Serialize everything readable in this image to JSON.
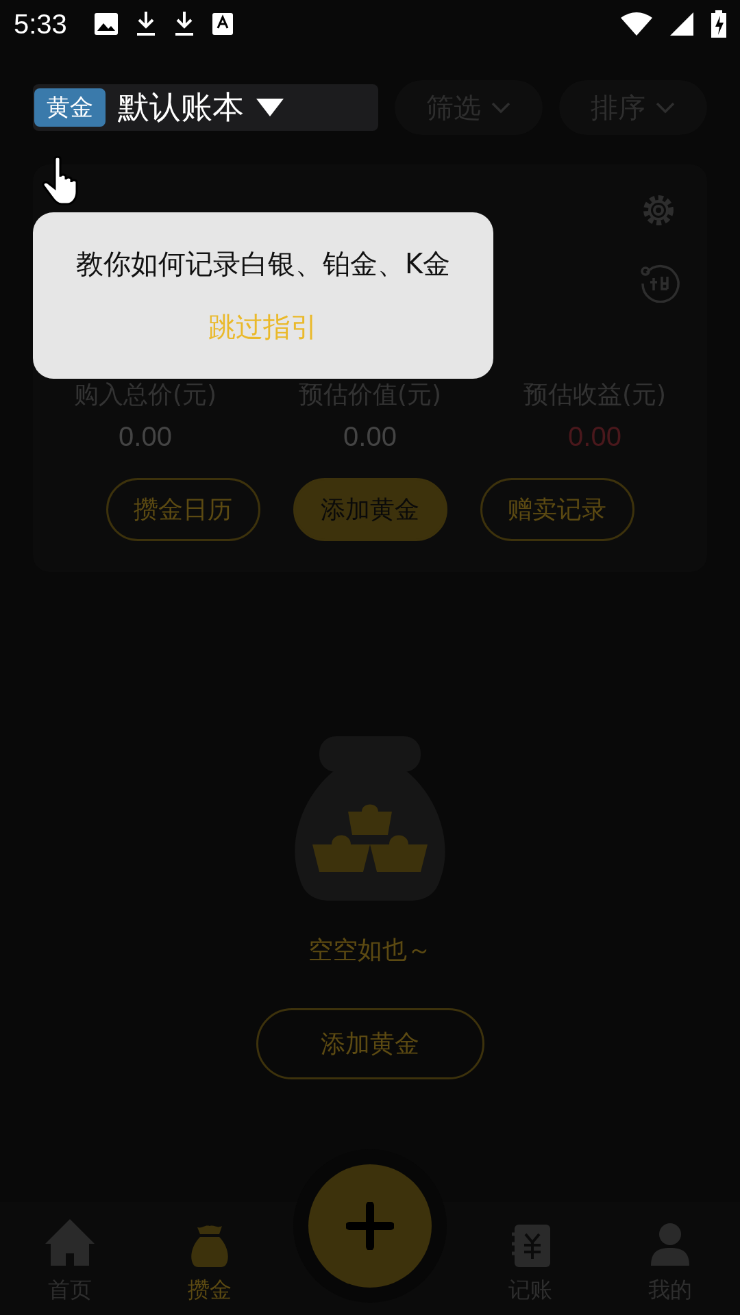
{
  "status_bar": {
    "time": "5:33"
  },
  "account": {
    "tag": "黄金",
    "name": "默认账本"
  },
  "filters": [
    {
      "label": "筛选"
    },
    {
      "label": "排序"
    }
  ],
  "summary": {
    "stats": [
      {
        "label": "购入总价(元)",
        "value": "0.00",
        "kind": "neutral"
      },
      {
        "label": "预估价值(元)",
        "value": "0.00",
        "kind": "neutral"
      },
      {
        "label": "预估收益(元)",
        "value": "0.00",
        "kind": "profit"
      }
    ],
    "actions": [
      {
        "label": "攒金日历",
        "kind": "outline"
      },
      {
        "label": "添加黄金",
        "kind": "filled"
      },
      {
        "label": "赠卖记录",
        "kind": "outline"
      }
    ]
  },
  "guide": {
    "text": "教你如何记录白银、铂金、K金",
    "skip": "跳过指引"
  },
  "empty": {
    "message": "空空如也～",
    "button": "添加黄金"
  },
  "nav": [
    {
      "label": "首页",
      "kind": "home",
      "selected": false
    },
    {
      "label": "攒金",
      "kind": "bag",
      "selected": true
    },
    {
      "label": "记账",
      "kind": "ledger",
      "selected": false
    },
    {
      "label": "我的",
      "kind": "person",
      "selected": false
    }
  ]
}
